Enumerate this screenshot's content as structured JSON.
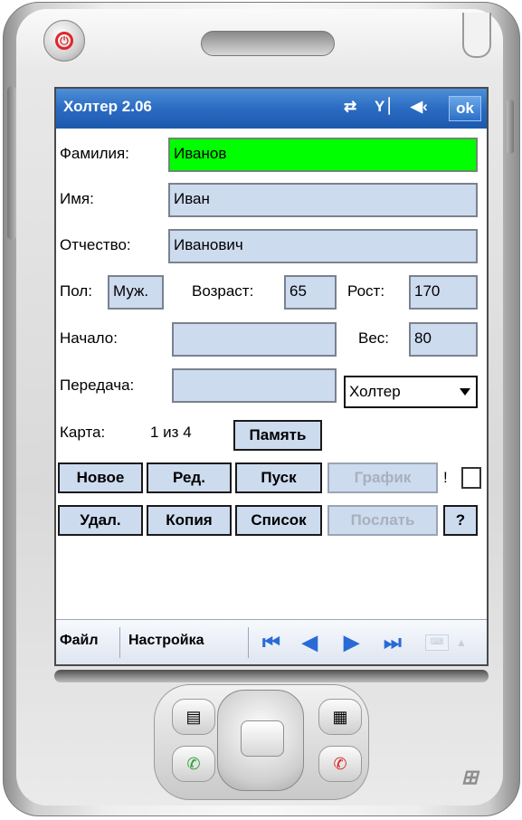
{
  "app": {
    "title": "Холтер 2.06",
    "ok_label": "ok"
  },
  "status_icons": {
    "sync": "⇄",
    "signal": "Y⏐",
    "volume": "◀‹"
  },
  "form": {
    "surname_label": "Фамилия:",
    "surname_value": "Иванов",
    "name_label": "Имя:",
    "name_value": "Иван",
    "patronymic_label": "Отчество:",
    "patronymic_value": "Иванович",
    "sex_label": "Пол:",
    "sex_value": "Муж.",
    "age_label": "Возраст:",
    "age_value": "65",
    "height_label": "Рост:",
    "height_value": "170",
    "start_label": "Начало:",
    "start_value": "",
    "weight_label": "Вес:",
    "weight_value": "80",
    "transfer_label": "Передача:",
    "transfer_value": "",
    "device_select": "Холтер",
    "card_label": "Карта:",
    "card_counter": "1 из 4",
    "memory_button": "Память"
  },
  "buttons": {
    "new": "Новое",
    "edit": "Ред.",
    "start": "Пуск",
    "chart": "График",
    "exclaim": "!",
    "delete": "Удал.",
    "copy": "Копия",
    "list": "Список",
    "send": "Послать",
    "help": "?"
  },
  "menubar": {
    "file": "Файл",
    "settings": "Настройка"
  },
  "nav_icons": {
    "first": "first-icon",
    "prev": "prev-icon",
    "next": "next-icon",
    "last": "last-icon"
  },
  "colors": {
    "titlebar": "#2a6bc2",
    "field_bg": "#cddbef",
    "active_field": "#00ff00",
    "power_red": "#e0262b"
  }
}
